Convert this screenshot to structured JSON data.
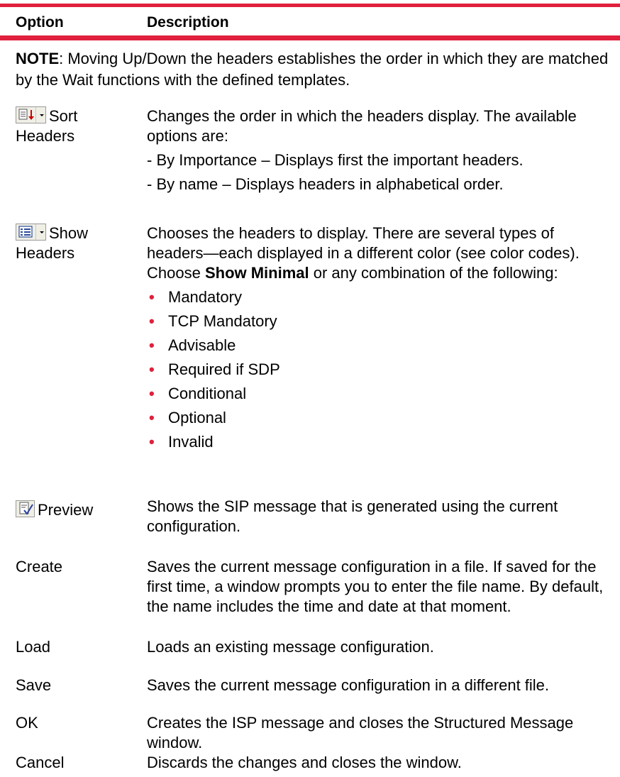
{
  "table": {
    "header_option": "Option",
    "header_description": "Description"
  },
  "note": {
    "label": "NOTE",
    "text": ": Moving Up/Down the headers establishes the order in which they are matched by the Wait functions with the defined templates."
  },
  "rows": {
    "sort": {
      "icon": "sort-dropdown-icon",
      "option_a": "Sort",
      "option_b": "Headers",
      "desc": "Changes the order in which the headers display. The available options are:",
      "sub1": "- By Importance – Displays first the important headers.",
      "sub2": "- By name – Displays headers in alphabetical order."
    },
    "show": {
      "icon": "show-headers-dropdown-icon",
      "option_a": "Show",
      "option_b": "Headers",
      "desc_before": "Chooses the headers to display. There are several types of headers—each displayed in a different color (see color codes). Choose ",
      "desc_bold": "Show Minimal",
      "desc_after": " or any combination of the following:",
      "bullets": [
        "Mandatory",
        "TCP Mandatory",
        "Advisable",
        "Required if SDP",
        "Conditional",
        "Optional",
        "Invalid"
      ]
    },
    "preview": {
      "icon": "preview-check-icon",
      "option": "Preview",
      "desc": "Shows the SIP message that is generated using the current configuration."
    },
    "create": {
      "option": "Create",
      "desc": "Saves the current message configuration in a file. If saved for the first time, a window prompts you to enter the file name. By default, the name includes the time and date at that moment."
    },
    "load": {
      "option": "Load",
      "desc": "Loads an existing message configuration."
    },
    "save": {
      "option": "Save",
      "desc": "Saves the current message configuration in a different file."
    },
    "ok": {
      "option": "OK",
      "desc": "Creates the ISP message and closes the Structured Message window."
    },
    "cancel": {
      "option": "Cancel",
      "desc": "Discards the changes and closes the window."
    }
  },
  "colors": {
    "accent_rule": "#e0203c",
    "bullet": "#e0203c"
  }
}
